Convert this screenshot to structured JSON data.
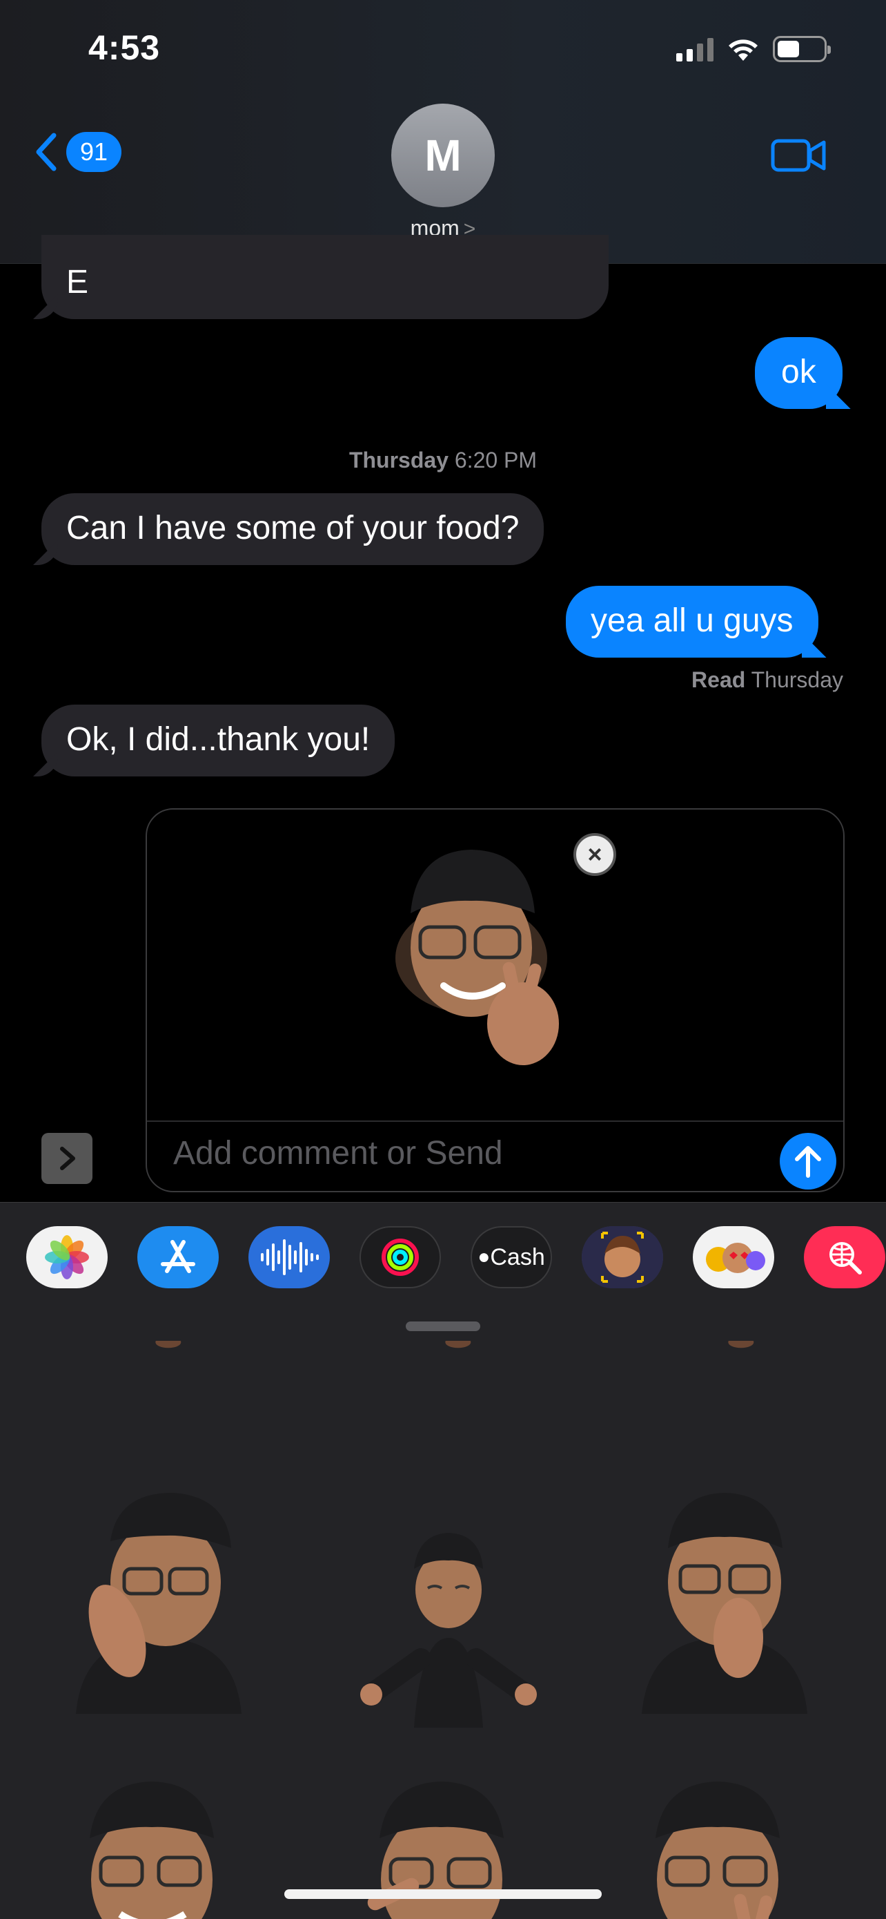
{
  "status": {
    "time": "4:53"
  },
  "header": {
    "back_badge": "91",
    "avatar_initial": "M",
    "contact_name": "mom",
    "contact_chevron": ">"
  },
  "messages": {
    "prev_incoming_text": "E",
    "out_ok": "ok",
    "timestamp_day": "Thursday",
    "timestamp_time": "6:20 PM",
    "in_food": "Can I have some of your food?",
    "out_guys": "yea all u guys",
    "read_label": "Read",
    "read_time": "Thursday",
    "in_thanks": "Ok, I did...thank you!"
  },
  "compose": {
    "placeholder": "Add comment or Send",
    "remove_symbol": "×"
  },
  "drawer": {
    "apps": [
      {
        "name": "photos-app",
        "label": ""
      },
      {
        "name": "app-store-app",
        "label": ""
      },
      {
        "name": "audio-app",
        "label": ""
      },
      {
        "name": "activity-app",
        "label": ""
      },
      {
        "name": "apple-cash-app",
        "label": "Cash"
      },
      {
        "name": "memoji-app",
        "label": ""
      },
      {
        "name": "memoji-stickers-app",
        "label": ""
      },
      {
        "name": "web-search-app",
        "label": ""
      }
    ]
  },
  "colors": {
    "accent": "#0a84ff",
    "incoming_bubble": "#26252a",
    "background": "#000000",
    "drawer_background": "#232326"
  },
  "icons": [
    "back-chevron-icon",
    "video-camera-icon",
    "wifi-icon",
    "battery-icon",
    "signal-icon",
    "send-arrow-icon",
    "expand-chevron-icon",
    "close-icon"
  ]
}
